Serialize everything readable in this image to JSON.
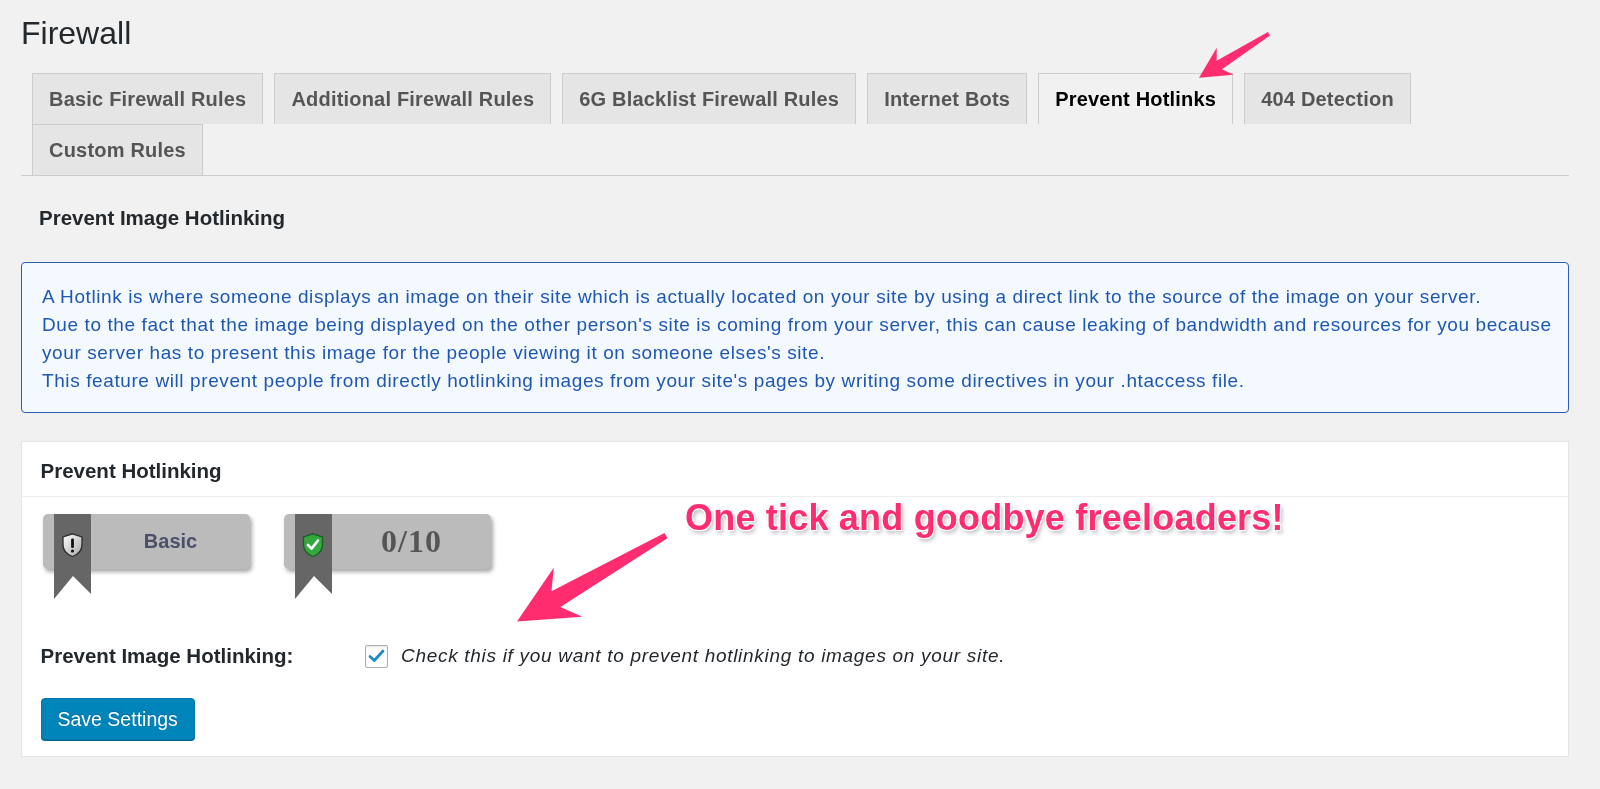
{
  "page_title": "Firewall",
  "tabs": [
    {
      "label": "Basic Firewall Rules",
      "selected": false
    },
    {
      "label": "Additional Firewall Rules",
      "selected": false
    },
    {
      "label": "6G Blacklist Firewall Rules",
      "selected": false
    },
    {
      "label": "Internet Bots",
      "selected": false
    },
    {
      "label": "Prevent Hotlinks",
      "selected": true
    },
    {
      "label": "404 Detection",
      "selected": false
    },
    {
      "label": "Custom Rules",
      "selected": false
    }
  ],
  "section": {
    "title": "Prevent Image Hotlinking",
    "info": [
      "A Hotlink is where someone displays an image on their site which is actually located on your site by using a direct link to the source of the image on your server.",
      "Due to the fact that the image being displayed on the other person's site is coming from your server, this can cause leaking of bandwidth and resources for you because your server has to present this image for the people viewing it on someone elses's site.",
      "This feature will prevent people from directly hotlinking images from your site's pages by writing some directives in your .htaccess file."
    ]
  },
  "panel": {
    "title": "Prevent Hotlinking",
    "badges": [
      {
        "kind": "level",
        "text": "Basic"
      },
      {
        "kind": "score",
        "text": "0/10"
      }
    ],
    "setting": {
      "label": "Prevent Image Hotlinking:",
      "checked": true,
      "description": "Check this if you want to prevent hotlinking to images on your site."
    },
    "button": "Save Settings"
  },
  "annotation": {
    "text": "One tick and goodbye freeloaders!"
  }
}
